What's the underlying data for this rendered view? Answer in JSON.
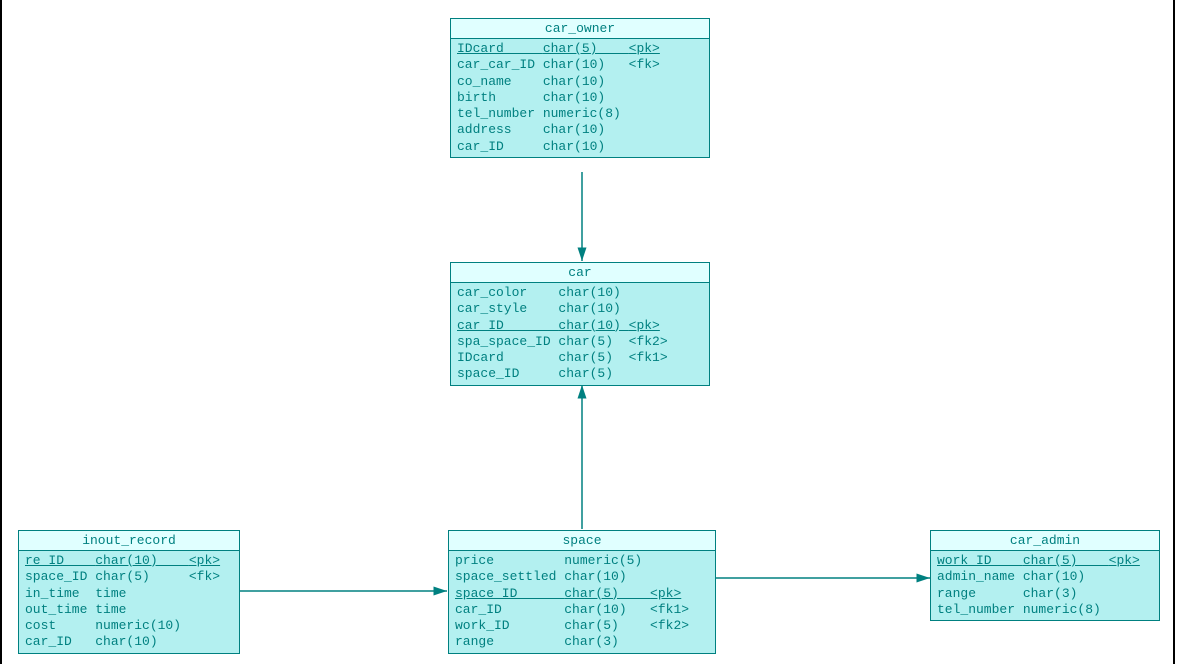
{
  "entities": {
    "car_owner": {
      "title": "car_owner",
      "rows": [
        {
          "name": "IDcard",
          "type": "char(5)",
          "key": "<pk>",
          "pk": true
        },
        {
          "name": "car_car_ID",
          "type": "char(10)",
          "key": "<fk>",
          "pk": false
        },
        {
          "name": "co_name",
          "type": "char(10)",
          "key": "",
          "pk": false
        },
        {
          "name": "birth",
          "type": "char(10)",
          "key": "",
          "pk": false
        },
        {
          "name": "tel_number",
          "type": "numeric(8)",
          "key": "",
          "pk": false
        },
        {
          "name": "address",
          "type": "char(10)",
          "key": "",
          "pk": false
        },
        {
          "name": "car_ID",
          "type": "char(10)",
          "key": "",
          "pk": false
        }
      ]
    },
    "car": {
      "title": "car",
      "rows": [
        {
          "name": "car_color",
          "type": "char(10)",
          "key": "",
          "pk": false
        },
        {
          "name": "car_style",
          "type": "char(10)",
          "key": "",
          "pk": false
        },
        {
          "name": "car_ID",
          "type": "char(10)",
          "key": "<pk>",
          "pk": true
        },
        {
          "name": "spa_space_ID",
          "type": "char(5)",
          "key": "<fk2>",
          "pk": false
        },
        {
          "name": "IDcard",
          "type": "char(5)",
          "key": "<fk1>",
          "pk": false
        },
        {
          "name": "space_ID",
          "type": "char(5)",
          "key": "",
          "pk": false
        }
      ]
    },
    "inout_record": {
      "title": "inout_record",
      "rows": [
        {
          "name": "re_ID",
          "type": "char(10)",
          "key": "<pk>",
          "pk": true
        },
        {
          "name": "space_ID",
          "type": "char(5)",
          "key": "<fk>",
          "pk": false
        },
        {
          "name": "in_time",
          "type": "time",
          "key": "",
          "pk": false
        },
        {
          "name": "out_time",
          "type": "time",
          "key": "",
          "pk": false
        },
        {
          "name": "cost",
          "type": "numeric(10)",
          "key": "",
          "pk": false
        },
        {
          "name": "car_ID",
          "type": "char(10)",
          "key": "",
          "pk": false
        }
      ]
    },
    "space": {
      "title": "space",
      "rows": [
        {
          "name": "price",
          "type": "numeric(5)",
          "key": "",
          "pk": false
        },
        {
          "name": "space_settled",
          "type": "char(10)",
          "key": "",
          "pk": false
        },
        {
          "name": "space_ID",
          "type": "char(5)",
          "key": "<pk>",
          "pk": true
        },
        {
          "name": "car_ID",
          "type": "char(10)",
          "key": "<fk1>",
          "pk": false
        },
        {
          "name": "work_ID",
          "type": "char(5)",
          "key": "<fk2>",
          "pk": false
        },
        {
          "name": "range",
          "type": "char(3)",
          "key": "",
          "pk": false
        }
      ]
    },
    "car_admin": {
      "title": "car_admin",
      "rows": [
        {
          "name": "work_ID",
          "type": "char(5)",
          "key": "<pk>",
          "pk": true
        },
        {
          "name": "admin_name",
          "type": "char(10)",
          "key": "",
          "pk": false
        },
        {
          "name": "range",
          "type": "char(3)",
          "key": "",
          "pk": false
        },
        {
          "name": "tel_number",
          "type": "numeric(8)",
          "key": "",
          "pk": false
        }
      ]
    }
  },
  "relations": [
    {
      "from": "car_owner",
      "to": "car"
    },
    {
      "from": "inout_record",
      "to": "space"
    },
    {
      "from": "space",
      "to": "car"
    },
    {
      "from": "space",
      "to": "car_admin"
    }
  ],
  "colors": {
    "stroke": "#008080",
    "fill": "#b3f0f0",
    "title_fill": "#e0ffff"
  }
}
